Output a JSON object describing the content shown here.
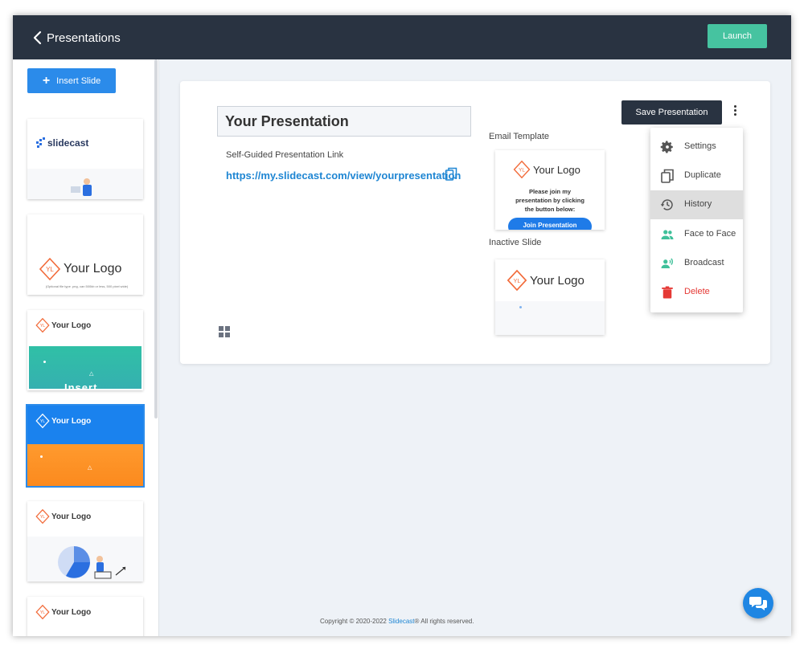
{
  "topbar": {
    "title": "Presentations",
    "launch_label": "Launch"
  },
  "sidebar": {
    "insert_label": "Insert Slide",
    "thumbs": [
      {
        "logo": "slidecast"
      },
      {
        "logo": "Your Logo",
        "caption": "(Optional file type .png, can 500kb or less, 500 pixel wide)"
      },
      {
        "logo": "Your Logo",
        "banner_text": "Insert"
      },
      {
        "logo": "Your Logo",
        "active": true
      },
      {
        "logo": "Your Logo"
      },
      {
        "logo": "Your Logo"
      }
    ]
  },
  "main": {
    "presentation_title": "Your Presentation",
    "link_label": "Self-Guided Presentation Link",
    "link_url": "https://my.slidecast.com/view/yourpresentation",
    "email_template_label": "Email Template",
    "inactive_slide_label": "Inactive Slide",
    "email_preview": {
      "logo": "Your Logo",
      "line1": "Please join my",
      "line2": "presentation by clicking",
      "line3": "the button below:",
      "button": "Join Presentation"
    },
    "inactive_preview": {
      "logo": "Your Logo"
    },
    "save_label": "Save Presentation"
  },
  "menu": {
    "items": [
      {
        "label": "Settings",
        "icon": "gear-icon"
      },
      {
        "label": "Duplicate",
        "icon": "copy-icon"
      },
      {
        "label": "History",
        "icon": "history-icon"
      },
      {
        "label": "Face to Face",
        "icon": "people-icon"
      },
      {
        "label": "Broadcast",
        "icon": "broadcast-icon"
      },
      {
        "label": "Delete",
        "icon": "trash-icon"
      }
    ]
  },
  "footer": {
    "prefix": "Copyright © 2020-2022 ",
    "brand": "Slidecast",
    "suffix": "® All rights reserved."
  },
  "colors": {
    "topbar": "#293341",
    "accent": "#2b8bea",
    "launch": "#46c3a0",
    "logo_orange": "#f26b3a",
    "delete": "#e53935",
    "face_to_face": "#3fc09a"
  }
}
